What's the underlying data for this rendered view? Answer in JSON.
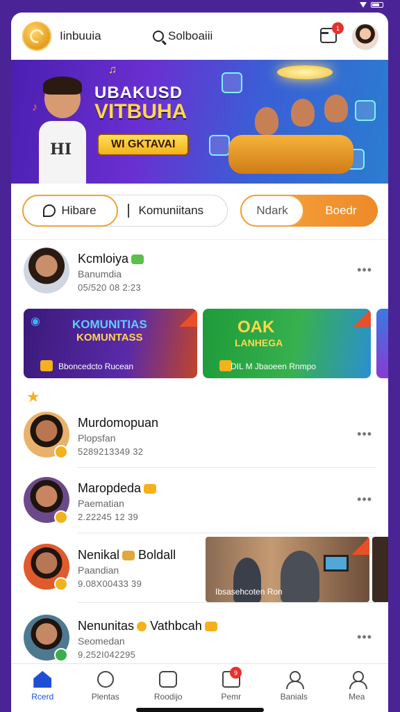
{
  "header": {
    "app_title": "Iinbuuia",
    "search_label": "Solboaiii",
    "inbox_badge": "1"
  },
  "hero": {
    "headline_1": "UBAKUSD",
    "headline_2": "VITBUHA",
    "cta": "WI GKTAVAI"
  },
  "tabs": {
    "left_active": "Hibare",
    "left_inactive": "Komuniitans",
    "right_off": "Ndark",
    "right_on": "Boedr"
  },
  "feed": {
    "first": {
      "name": "Kcmloiya",
      "sub": "Banumdia",
      "num": "05/520 08 2:23"
    },
    "promos": [
      {
        "title_1": "KOMUNITIAS",
        "title_2": "KOMUNTASS",
        "foot": "Bboncedcto Rucean"
      },
      {
        "title_1": "OAK",
        "title_2": "LANHEGA",
        "foot": "DIL M Jbaoeen Rnmpo"
      }
    ],
    "items": [
      {
        "name": "Murdomopuan",
        "sub": "Plopsfan",
        "num": "5289213349 32"
      },
      {
        "name": "Maropdeda",
        "sub": "Paematian",
        "num": "2.22245 12 39"
      },
      {
        "name": "Nenikal",
        "name_2": "Boldall",
        "sub": "Paandian",
        "num": "9.08X00433 39"
      },
      {
        "name": "Nenunitas",
        "name_2": "Vathbcah",
        "sub": "Seomedan",
        "num": "9.252I042295"
      }
    ],
    "video_caption": "Ibsasehcoten Ron"
  },
  "nav": {
    "items": [
      "Rcerd",
      "Plentas",
      "Roodijo",
      "Pemr",
      "Banials",
      "Mea"
    ],
    "badge": "9"
  }
}
